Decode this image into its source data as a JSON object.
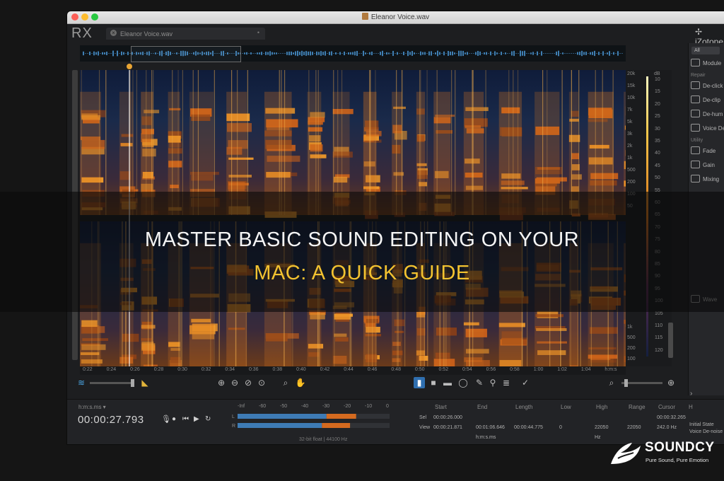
{
  "window": {
    "title": "Eleanor Voice.wav",
    "app_logo": "RX",
    "file_tab": "Eleanor Voice.wav",
    "brand_corner": "iZotope"
  },
  "right_panel": {
    "filter": "All",
    "items": [
      {
        "label": "Module",
        "icon": "list-icon"
      },
      {
        "header": "Repair"
      },
      {
        "label": "De-click",
        "icon": "wave-icon"
      },
      {
        "label": "De-clip",
        "icon": "clip-icon"
      },
      {
        "label": "De-hum",
        "icon": "bolt-icon"
      },
      {
        "label": "Voice De",
        "icon": "voice-icon"
      },
      {
        "header": "Utility"
      },
      {
        "label": "Fade",
        "icon": "fade-icon"
      },
      {
        "label": "Gain",
        "icon": "gain-icon"
      },
      {
        "label": "Mixing",
        "icon": "mix-icon"
      },
      {
        "label": "Wave",
        "icon": "wave-icon"
      }
    ]
  },
  "freq_scale": [
    "20k",
    "15k",
    "10k",
    "7k",
    "5k",
    "3k",
    "2k",
    "1k",
    "500",
    "200",
    "100",
    "50",
    "1k",
    "500",
    "200",
    "100"
  ],
  "db_scale": [
    "10",
    "15",
    "20",
    "25",
    "30",
    "35",
    "40",
    "45",
    "50",
    "55",
    "60",
    "65",
    "70",
    "75",
    "80",
    "85",
    "90",
    "95",
    "100",
    "105",
    "110",
    "115",
    "120"
  ],
  "db_header": "dB",
  "time_ruler": [
    "0:22",
    "0:24",
    "0:26",
    "0:28",
    "0:30",
    "0:32",
    "0:34",
    "0:36",
    "0:38",
    "0:40",
    "0:42",
    "0:44",
    "0:46",
    "0:48",
    "0:50",
    "0:52",
    "0:54",
    "0:56",
    "0:58",
    "1:00",
    "1:02",
    "1:04",
    "h:m:s"
  ],
  "bottom": {
    "time_format": "h:m:s.ms ▾",
    "current_time": "00:00:27.793",
    "meter_scale": [
      "-Inf",
      "-60",
      "-50",
      "-40",
      "-30",
      "-20",
      "-10",
      "0"
    ],
    "meter_levels": {
      "L": 0.78,
      "R": 0.74
    },
    "format_info": "32-bit float | 44100 Hz",
    "sel_headers": [
      "Start",
      "End",
      "Length",
      "Low",
      "High",
      "Range",
      "Cursor"
    ],
    "sel_row": [
      "Sel",
      "00:00:26.000",
      "",
      "",
      "",
      "",
      "",
      "00:00:32.265"
    ],
    "view_row": [
      "View",
      "00:00:21.871",
      "00:01:06.646",
      "00:00:44.775",
      "0",
      "22050",
      "22050",
      "242.0 Hz"
    ],
    "units": [
      "h:m:s.ms",
      "Hz"
    ],
    "history": [
      "Initial State",
      "Voice De-noise"
    ]
  },
  "overlay": {
    "line1": "MASTER BASIC SOUND EDITING ON YOUR",
    "line2": "MAC: A QUICK GUIDE"
  },
  "brand": {
    "name": "SOUNDCY",
    "tagline": "Pure Sound, Pure Emotion"
  },
  "colors": {
    "accent": "#f2c230",
    "spectrogram_hot": "#e07a1a",
    "spectrogram_cold": "#142040"
  }
}
